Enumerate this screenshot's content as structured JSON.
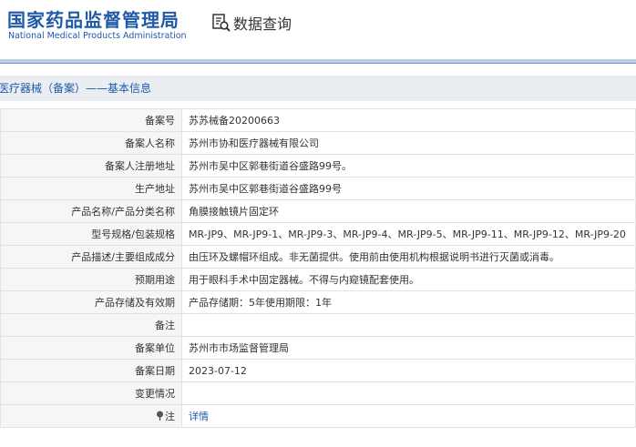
{
  "header": {
    "logo_cn": "国家药品监督管理局",
    "logo_en": "National Medical Products Administration",
    "query_title": "数据查询",
    "query_icon": "document-search-icon"
  },
  "section": {
    "title": "医疗器械（备案）——基本信息"
  },
  "rows": [
    {
      "label": "备案号",
      "value": "苏苏械备20200663"
    },
    {
      "label": "备案人名称",
      "value": "苏州市协和医疗器械有限公司"
    },
    {
      "label": "备案人注册地址",
      "value": "苏州市吴中区郭巷街道谷盛路99号。"
    },
    {
      "label": "生产地址",
      "value": "苏州市吴中区郭巷街道谷盛路99号"
    },
    {
      "label": "产品名称/产品分类名称",
      "value": "角膜接触镜片固定环"
    },
    {
      "label": "型号规格/包装规格",
      "value": "MR-JP9、MR-JP9-1、MR-JP9-3、MR-JP9-4、MR-JP9-5、MR-JP9-11、MR-JP9-12、MR-JP9-20"
    },
    {
      "label": "产品描述/主要组成成分",
      "value": "由压环及螺帽环组成。非无菌提供。使用前由使用机构根据说明书进行灭菌或消毒。"
    },
    {
      "label": "预期用途",
      "value": "用于眼科手术中固定器械。不得与内窥镜配套使用。"
    },
    {
      "label": "产品存储及有效期",
      "value": "产品存储期：5年使用期限：1年"
    },
    {
      "label": "备注",
      "value": ""
    },
    {
      "label": "备案单位",
      "value": "苏州市市场监督管理局"
    },
    {
      "label": "备案日期",
      "value": "2023-07-12"
    },
    {
      "label": "变更情况",
      "value": ""
    }
  ],
  "detail_row": {
    "label": "注",
    "link": "详情",
    "icon": "pin-icon"
  },
  "colors": {
    "brand_blue": "#1f5aa6",
    "band": "#b6cde4",
    "section_bg": "#eaeef2"
  }
}
